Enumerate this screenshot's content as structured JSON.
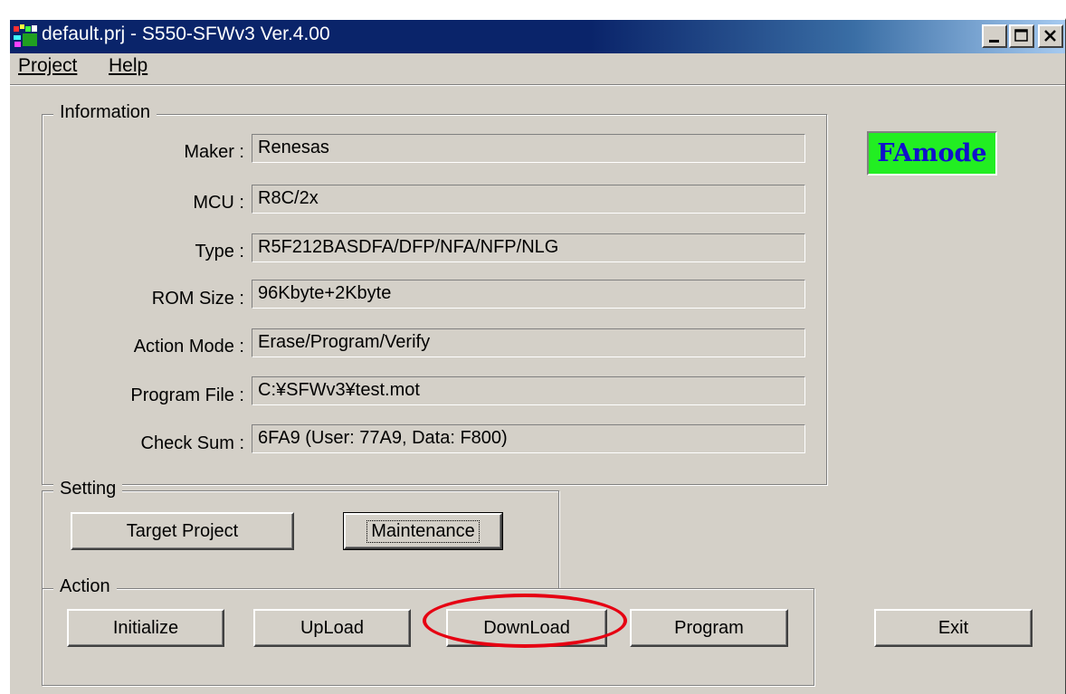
{
  "window": {
    "title": "default.prj - S550-SFWv3 Ver.4.00",
    "controls": {
      "minimize": "minimize-icon",
      "maximize": "maximize-icon",
      "close": "close-icon"
    }
  },
  "menu": {
    "items": [
      {
        "label": "Project",
        "accel": "P"
      },
      {
        "label": "Help",
        "accel": "H"
      }
    ]
  },
  "information": {
    "legend": "Information",
    "rows": [
      {
        "label": "Maker :",
        "value": "Renesas"
      },
      {
        "label": "MCU :",
        "value": "R8C/2x"
      },
      {
        "label": "Type :",
        "value": "R5F212BASDFA/DFP/NFA/NFP/NLG"
      },
      {
        "label": "ROM Size :",
        "value": "96Kbyte+2Kbyte"
      },
      {
        "label": "Action Mode :",
        "value": "Erase/Program/Verify"
      },
      {
        "label": "Program File :",
        "value": "C:¥SFWv3¥test.mot"
      },
      {
        "label": "Check Sum :",
        "value": "6FA9 (User: 77A9, Data: F800)"
      }
    ]
  },
  "mode_indicator": {
    "text": "FAmode",
    "background": "#22ee22",
    "color": "#1010cc"
  },
  "setting": {
    "legend": "Setting",
    "buttons": {
      "target_project": "Target Project",
      "maintenance": "Maintenance"
    }
  },
  "action": {
    "legend": "Action",
    "buttons": {
      "initialize": "Initialize",
      "upload": "UpLoad",
      "download": "DownLoad",
      "program": "Program"
    }
  },
  "exit_button": "Exit",
  "highlight": {
    "target": "DownLoad",
    "color": "#e60012"
  }
}
